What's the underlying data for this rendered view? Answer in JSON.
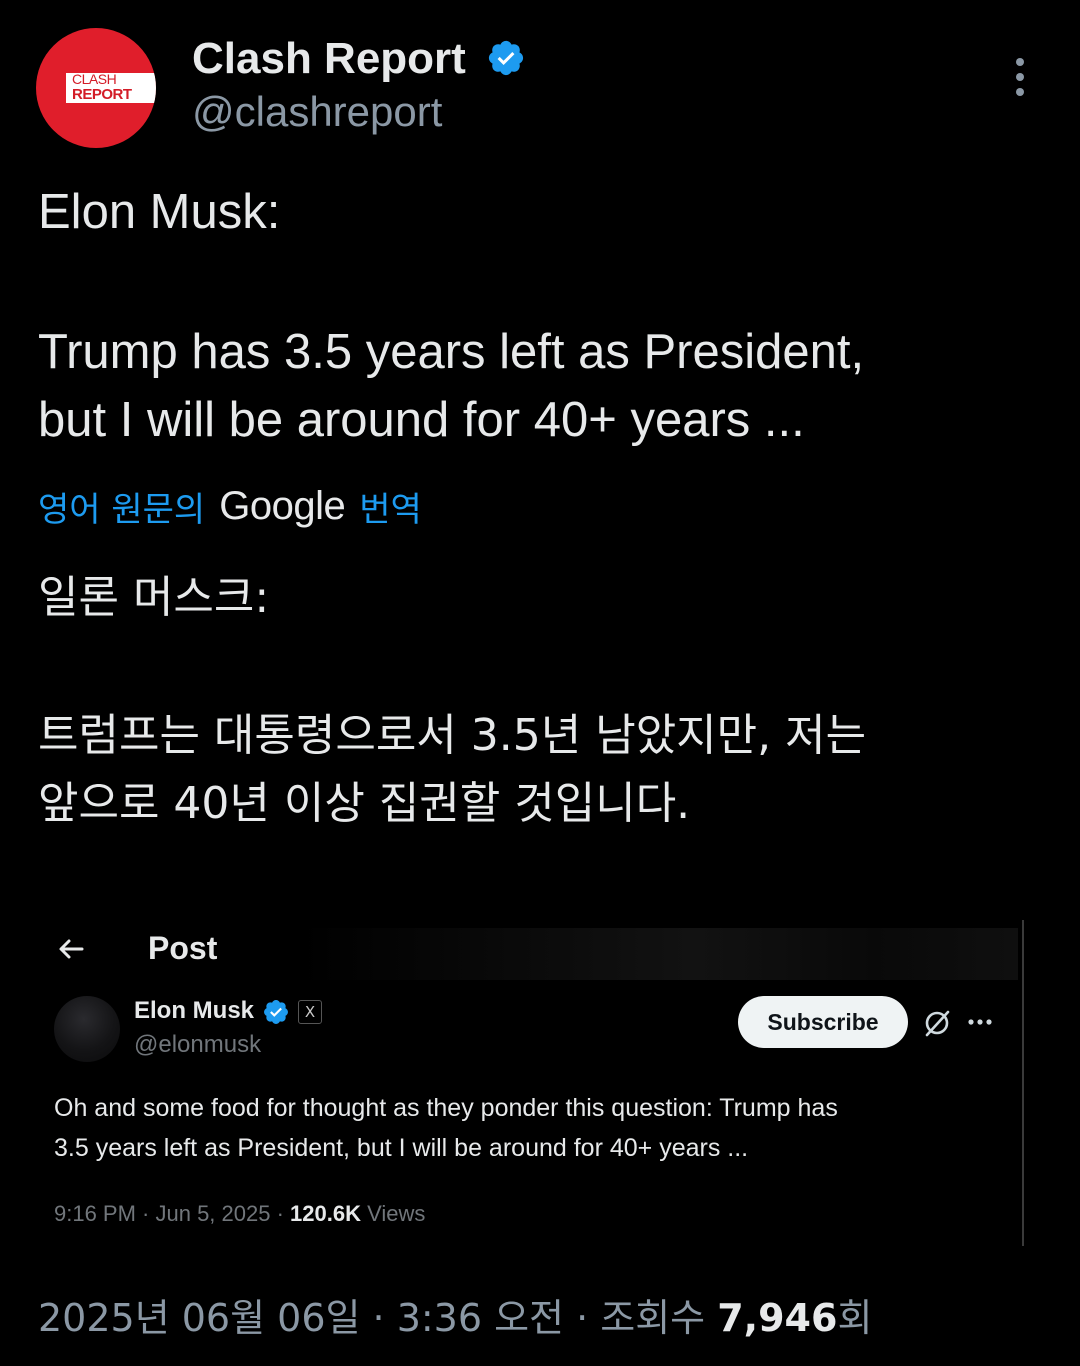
{
  "author": {
    "display_name": "Clash Report",
    "handle": "@clashreport",
    "avatar_logo_top": "CLASH",
    "avatar_logo_bottom": "REPORT",
    "verified_icon": "verified-badge-icon",
    "brand_color": "#e01e2b"
  },
  "tweet": {
    "lines": [
      "Elon Musk:",
      "Trump has 3.5 years left as President,",
      "but I will be around for 40+ years ..."
    ]
  },
  "translation": {
    "prefix": "영어 원문의",
    "provider": "Google",
    "suffix": "번역",
    "lines": [
      "일론 머스크:",
      "트럼프는 대통령으로서 3.5년 남았지만, 저는",
      "앞으로 40년 이상 집권할 것입니다."
    ]
  },
  "embedded_post": {
    "header_title": "Post",
    "author_name": "Elon Musk",
    "author_handle": "@elonmusk",
    "badge_label": "X",
    "subscribe_label": "Subscribe",
    "body_lines": [
      "Oh and some food for thought as they ponder this question: Trump has",
      "3.5 years left as President, but I will be around for 40+ years ..."
    ],
    "time_date": "9:16 PM · Jun 5, 2025 · ",
    "views_count": "120.6K",
    "views_label": " Views"
  },
  "footer": {
    "timestamp": "2025년 06월 06일 · 3:36 오전 · 조회수 ",
    "views_count": "7,946",
    "views_suffix": "회"
  },
  "colors": {
    "background": "#000000",
    "text_primary": "#e7e9ea",
    "text_secondary": "#8b98a5",
    "link_blue": "#1d9bf0",
    "verified_blue": "#1d9bf0"
  }
}
